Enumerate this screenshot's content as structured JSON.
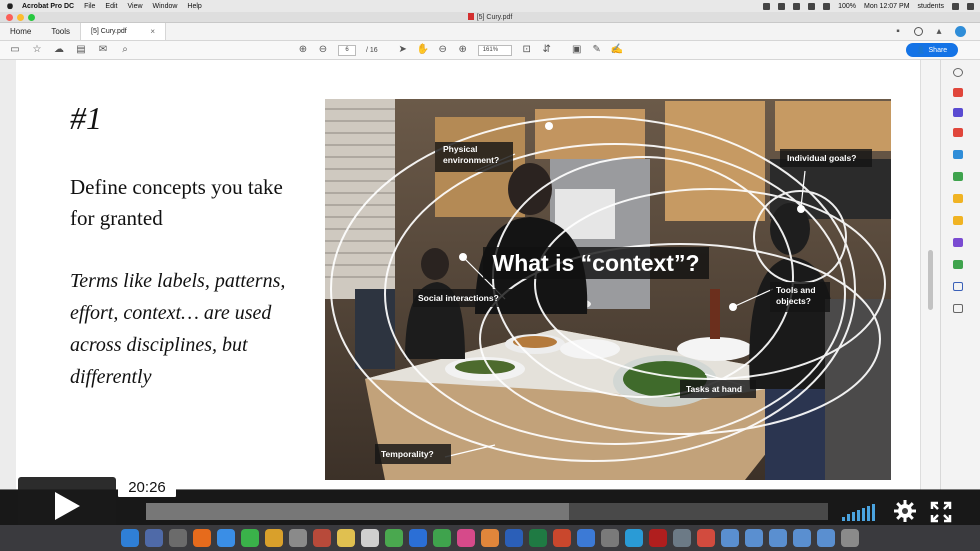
{
  "menubar": {
    "app_name": "Acrobat Pro DC",
    "menus": [
      "File",
      "Edit",
      "View",
      "Window",
      "Help"
    ],
    "battery": "100%",
    "clock": "Mon 12:07 PM",
    "user": "students"
  },
  "window": {
    "title": "[5] Cury.pdf"
  },
  "tabs": {
    "home": "Home",
    "tools": "Tools",
    "document_tab": "[5] Cury.pdf",
    "close_glyph": "×"
  },
  "toolbar": {
    "current_page": "6",
    "page_total": "/ 16",
    "zoom": "161%",
    "share_label": "Share"
  },
  "slide": {
    "number": "#1",
    "title": "Define concepts you take for granted",
    "body": "Terms like labels, patterns, effort, context… are used across disciplines, but differently"
  },
  "photo": {
    "headline": "What is “context”?",
    "label_physical_line1": "Physical",
    "label_physical_line2": "environment?",
    "label_goals": "Individual goals?",
    "label_social": "Social interactions?",
    "label_tools_line1": "Tools and",
    "label_tools_line2": "objects?",
    "label_tasks": "Tasks at hand",
    "label_temporality": "Temporality?"
  },
  "player": {
    "timestamp": "20:26",
    "progress_fraction": 0.62
  },
  "colors": {
    "accent_blue": "#1473e6",
    "player_blue": "#4aa3df"
  }
}
